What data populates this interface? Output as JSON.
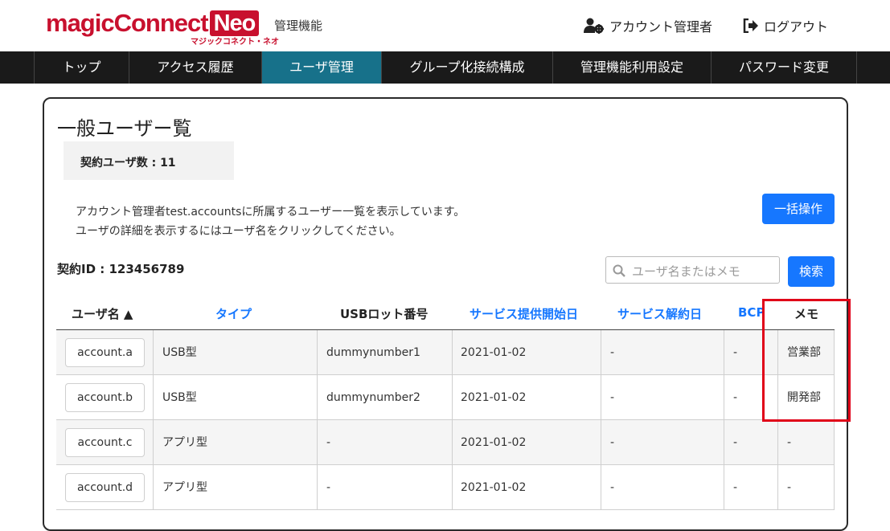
{
  "header": {
    "logo_magic": "magic",
    "logo_connect": "Connect",
    "logo_neo": "Neo",
    "logo_sub": "マジックコネクト・ネオ",
    "admin_label": "管理機能",
    "account_admin": "アカウント管理者",
    "logout": "ログアウト"
  },
  "nav": {
    "items": [
      {
        "label": "トップ"
      },
      {
        "label": "アクセス履歴"
      },
      {
        "label": "ユーザ管理",
        "active": true
      },
      {
        "label": "グループ化接続構成"
      },
      {
        "label": "管理機能利用設定"
      },
      {
        "label": "パスワード変更"
      }
    ]
  },
  "main": {
    "title": "一般ユーザー覧",
    "contract_count": "契約ユーザ数 : 11",
    "description_line1": "アカウント管理者test.accountsに所属するユーザー一覧を表示しています。",
    "description_line2": "ユーザの詳細を表示するにはユーザ名をクリックしてください。",
    "bulk_button": "一括操作",
    "contract_id": "契約ID : 123456789",
    "search_placeholder": "ユーザ名またはメモ",
    "search_button": "検索"
  },
  "table": {
    "headers": {
      "user": "ユーザ名 ▲",
      "type": "タイプ",
      "usb": "USBロット番号",
      "start": "サービス提供開始日",
      "end": "サービス解約日",
      "bcp": "BCP",
      "memo": "メモ"
    },
    "rows": [
      {
        "user": "account.a",
        "type": "USB型",
        "usb": "dummynumber1",
        "start": "2021-01-02",
        "end": "-",
        "bcp": "-",
        "memo": "営業部"
      },
      {
        "user": "account.b",
        "type": "USB型",
        "usb": "dummynumber2",
        "start": "2021-01-02",
        "end": "-",
        "bcp": "-",
        "memo": "開発部"
      },
      {
        "user": "account.c",
        "type": "アプリ型",
        "usb": "-",
        "start": "2021-01-02",
        "end": "-",
        "bcp": "-",
        "memo": "-"
      },
      {
        "user": "account.d",
        "type": "アプリ型",
        "usb": "-",
        "start": "2021-01-02",
        "end": "-",
        "bcp": "-",
        "memo": "-"
      }
    ]
  },
  "colors": {
    "brand_red": "#c8102e",
    "nav_bg": "#1a1a1a",
    "nav_active": "#17718a",
    "accent_blue": "#1677ff",
    "highlight_red": "#e00018"
  }
}
